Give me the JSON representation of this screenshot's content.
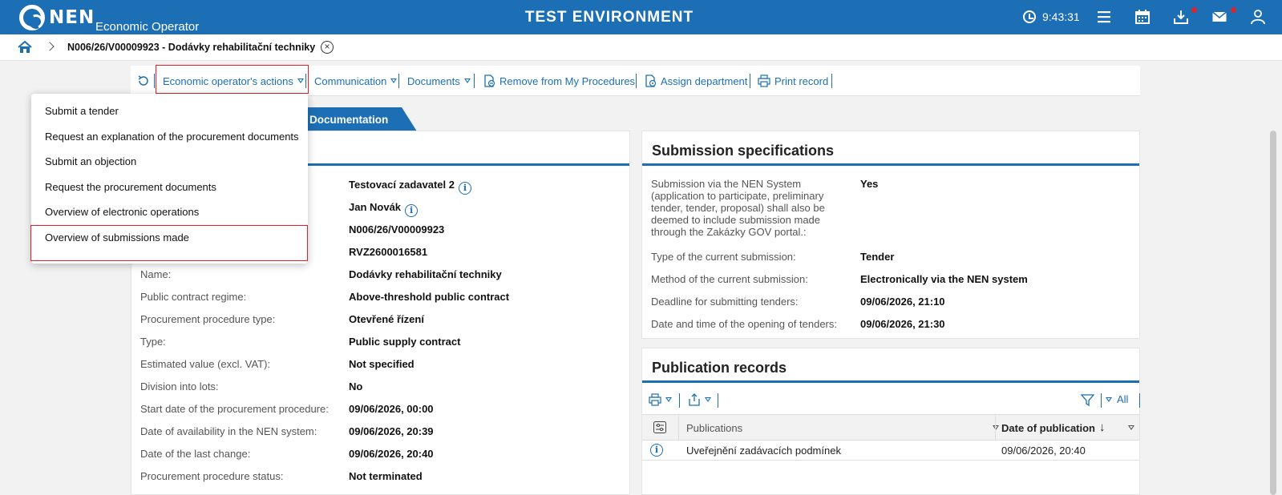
{
  "header": {
    "logo_text": "NEN",
    "logo_sub": "Economic Operator",
    "env_title": "TEST ENVIRONMENT",
    "time": "9:43:31"
  },
  "breadcrumb": {
    "title": "N006/26/V00009923 - Dodávky rehabilitační techniky"
  },
  "toolbar": {
    "items": [
      {
        "label": "Economic operator's actions"
      },
      {
        "label": "Communication"
      },
      {
        "label": "Documents"
      },
      {
        "label": "Remove from My Procedures"
      },
      {
        "label": "Assign department"
      },
      {
        "label": "Print record"
      }
    ]
  },
  "tab": {
    "label": "Documentation"
  },
  "menu": {
    "items": [
      {
        "label": "Submit a tender"
      },
      {
        "label": "Request an explanation of the procurement documents"
      },
      {
        "label": "Submit an objection"
      },
      {
        "label": "Request the procurement documents"
      },
      {
        "label": "Overview of electronic operations"
      },
      {
        "label": "Overview of submissions made"
      }
    ]
  },
  "details": {
    "rows": [
      {
        "label": "",
        "value": "Testovací zadavatel 2"
      },
      {
        "label": "",
        "value": "Jan Novák"
      },
      {
        "label": "",
        "value": "N006/26/V00009923"
      },
      {
        "label": "",
        "value": "RVZ2600016581"
      },
      {
        "label": "Name:",
        "value": "Dodávky rehabilitační techniky"
      },
      {
        "label": "Public contract regime:",
        "value": "Above-threshold public contract"
      },
      {
        "label": "Procurement procedure type:",
        "value": "Otevřené řízení"
      },
      {
        "label": "Type:",
        "value": "Public supply contract"
      },
      {
        "label": "Estimated value (excl. VAT):",
        "value": "Not specified"
      },
      {
        "label": "Division into lots:",
        "value": "No"
      },
      {
        "label": "Start date of the procurement procedure:",
        "value": "09/06/2026, 00:00"
      },
      {
        "label": "Date of availability in the NEN system:",
        "value": "09/06/2026, 20:39"
      },
      {
        "label": "Date of the last change:",
        "value": "09/06/2026, 20:40"
      },
      {
        "label": "Procurement procedure status:",
        "value": "Not terminated"
      }
    ]
  },
  "submission": {
    "title": "Submission specifications",
    "rows": [
      {
        "label": "Submission via the NEN System (application to participate, preliminary tender, tender, proposal) shall also be deemed to include submission made through the Zakázky GOV portal.:",
        "value": "Yes"
      },
      {
        "label": "Type of the current submission:",
        "value": "Tender"
      },
      {
        "label": "Method of the current submission:",
        "value": "Electronically via the NEN system"
      },
      {
        "label": "Deadline for submitting tenders:",
        "value": "09/06/2026, 21:10"
      },
      {
        "label": "Date and time of the opening of tenders:",
        "value": "09/06/2026, 21:30"
      }
    ]
  },
  "publication": {
    "title": "Publication records",
    "filter_label": "All",
    "columns": [
      "Publications",
      "Date of publication"
    ],
    "rows": [
      {
        "name": "Uveřejnění zadávacích podmínek",
        "date": "09/06/2026, 20:40"
      }
    ]
  },
  "colors": {
    "brand": "#1c6fb5",
    "highlight": "#e0202a",
    "badge": "#d9262f"
  }
}
